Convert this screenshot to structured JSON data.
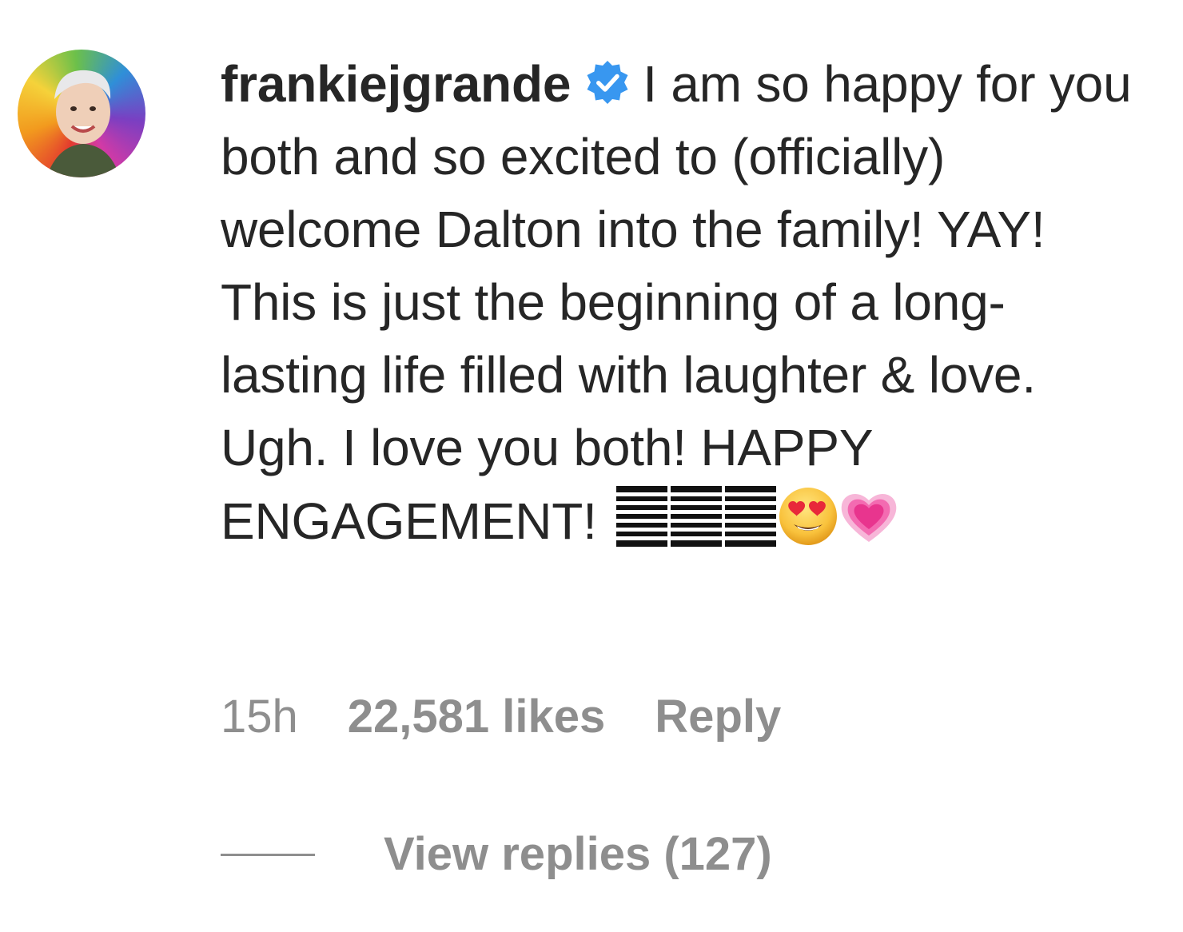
{
  "comment": {
    "avatar_icon": "profile-photo-avatar",
    "username": "frankiejgrande",
    "verified_icon": "verified-badge-icon",
    "verified_color": "#3897f0",
    "text": "I am so happy for you both and so excited to (officially) welcome Dalton into the family! YAY! This is just the beginning of a long-lasting life filled with laughter & love. Ugh. I love you both! HAPPY ENGAGEMENT!",
    "emojis": [
      "placeholder-box-glyph",
      "placeholder-box-glyph",
      "placeholder-box-glyph",
      "heart-eyes-emoji",
      "growing-heart-emoji"
    ],
    "timestamp": "15h",
    "likes": "22,581 likes",
    "reply_label": "Reply",
    "view_replies_label": "View replies (127)"
  },
  "colors": {
    "text": "#262626",
    "secondary": "#8e8e8e",
    "verified": "#3897f0"
  }
}
